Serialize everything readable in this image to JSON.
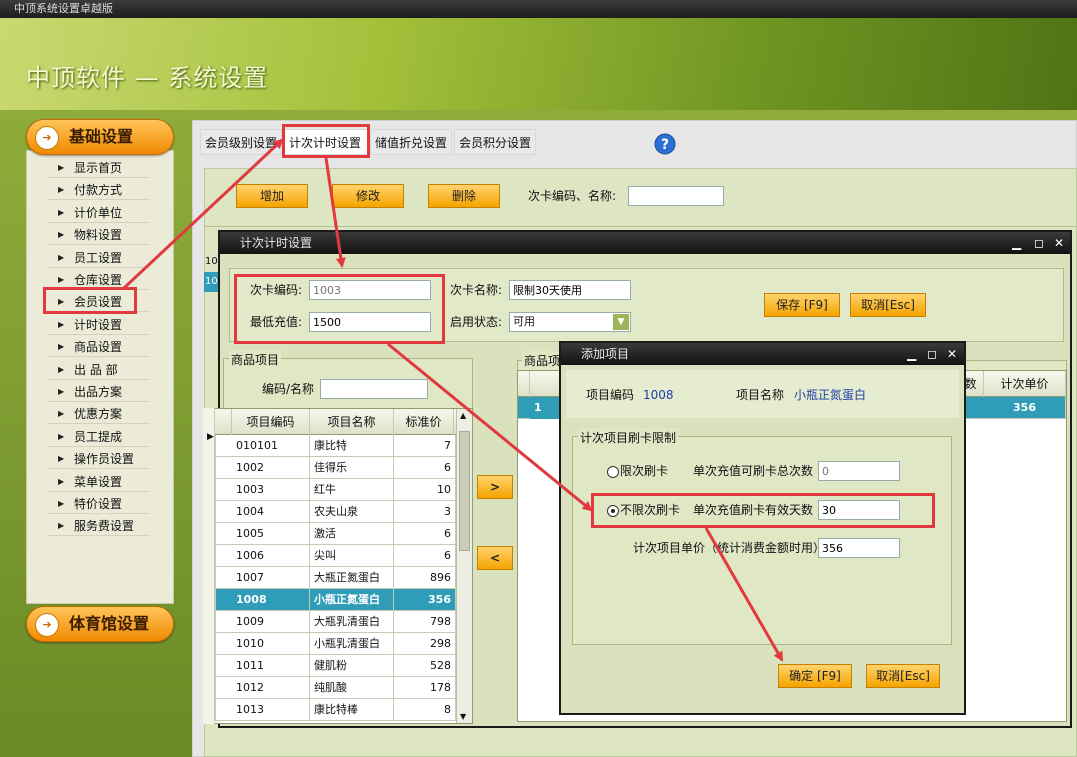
{
  "app": {
    "window_title": "中顶系统设置卓越版",
    "header_title": "中顶软件 — 系统设置"
  },
  "sidebar": {
    "section1": "基础设置",
    "items": [
      "显示首页",
      "付款方式",
      "计价单位",
      "物料设置",
      "员工设置",
      "仓库设置",
      "会员设置",
      "计时设置",
      "商品设置",
      "出 品 部",
      "出品方案",
      "优惠方案",
      "员工提成",
      "操作员设置",
      "菜单设置",
      "特价设置",
      "服务费设置"
    ],
    "section2": "体育馆设置"
  },
  "tabs": [
    "会员级别设置",
    "计次计时设置",
    "储值折兑设置",
    "会员积分设置"
  ],
  "toolbar": {
    "add": "增加",
    "edit": "修改",
    "delete": "删除",
    "search_label": "次卡编码、名称:",
    "search_value": ""
  },
  "bg_grid": {
    "row1": "10",
    "row2": "10"
  },
  "timer_dialog": {
    "title": "计次计时设置",
    "code_label": "次卡编码:",
    "code_value": "1003",
    "name_label": "次卡名称:",
    "name_value": "限制30天使用",
    "min_label": "最低充值:",
    "min_value": "1500",
    "status_label": "启用状态:",
    "status_value": "可用",
    "save": "保存 [F9]",
    "cancel": "取消[Esc]",
    "goods_panel": "商品项目",
    "search_label": "编码/名称",
    "search_value": "",
    "columns": [
      "项目编码",
      "项目名称",
      "标准价"
    ],
    "rows": [
      [
        "010101",
        "康比特",
        "7"
      ],
      [
        "1002",
        "佳得乐",
        "6"
      ],
      [
        "1003",
        "红牛",
        "10"
      ],
      [
        "1004",
        "农夫山泉",
        "3"
      ],
      [
        "1005",
        "激活",
        "6"
      ],
      [
        "1006",
        "尖叫",
        "6"
      ],
      [
        "1007",
        "大瓶正氮蛋白",
        "896"
      ],
      [
        "1008",
        "小瓶正氮蛋白",
        "356"
      ],
      [
        "1009",
        "大瓶乳清蛋白",
        "798"
      ],
      [
        "1010",
        "小瓶乳清蛋白",
        "298"
      ],
      [
        "1011",
        "健肌粉",
        "528"
      ],
      [
        "1012",
        "纯肌酸",
        "178"
      ],
      [
        "1013",
        "康比特棒",
        "8"
      ]
    ],
    "move_right": ">",
    "move_left": "<",
    "right_panel": "商品项",
    "right_col_num": "数",
    "right_col_price": "计次单价",
    "right_row_price": "356",
    "right_row_first": "1"
  },
  "add_dialog": {
    "title": "添加项目",
    "code_label": "项目编码",
    "code_value": "1008",
    "name_label": "项目名称",
    "name_value": "小瓶正氮蛋白",
    "group_title": "计次项目刷卡限制",
    "opt1": "限次刷卡",
    "opt1_desc": "单次充值可刷卡总次数",
    "opt1_value": "0",
    "opt2": "不限次刷卡",
    "opt2_desc": "单次充值刷卡有效天数",
    "opt2_value": "30",
    "price_label": "计次项目单价（统计消费金额时用）",
    "price_value": "356",
    "ok": "确定 [F9]",
    "cancel": "取消[Esc]"
  },
  "colors": {
    "accent_orange": "#f5a400",
    "selected_row": "#2f9db8",
    "highlight_red": "#e0393e"
  },
  "icons": [
    "help-icon",
    "minimize-icon",
    "maximize-icon",
    "close-icon",
    "dropdown-arrow-icon",
    "nav-triangle-icon",
    "pill-arrow-icon"
  ]
}
